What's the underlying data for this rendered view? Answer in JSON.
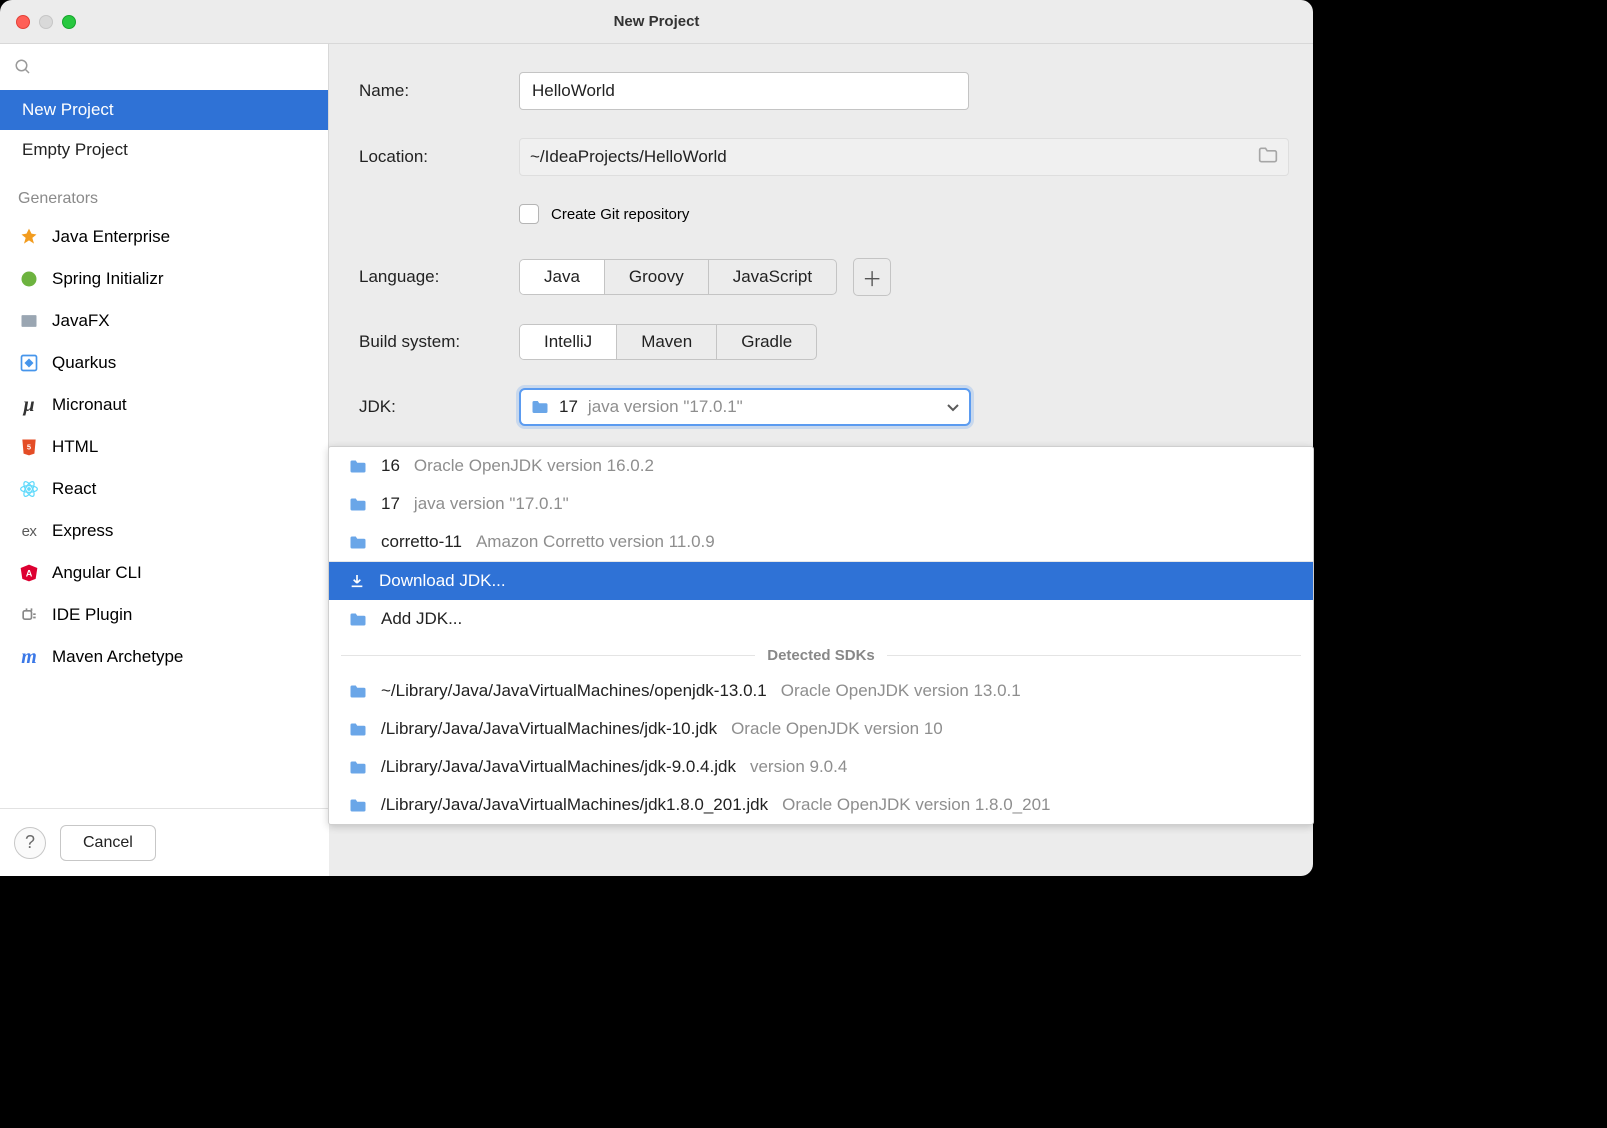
{
  "window": {
    "title": "New Project"
  },
  "sidebar": {
    "search_placeholder": "",
    "items": [
      {
        "label": "New Project",
        "selected": true
      },
      {
        "label": "Empty Project",
        "selected": false
      }
    ],
    "generators_label": "Generators",
    "generators": [
      {
        "label": "Java Enterprise",
        "icon": "rocket-icon",
        "color": "#f29c1f"
      },
      {
        "label": "Spring Initializr",
        "icon": "spring-icon",
        "color": "#6db33f"
      },
      {
        "label": "JavaFX",
        "icon": "javafx-icon",
        "color": "#888"
      },
      {
        "label": "Quarkus",
        "icon": "quarkus-icon",
        "color": "#4695eb"
      },
      {
        "label": "Micronaut",
        "icon": "micronaut-icon",
        "color": "#333"
      },
      {
        "label": "HTML",
        "icon": "html-icon",
        "color": "#e44d26"
      },
      {
        "label": "React",
        "icon": "react-icon",
        "color": "#61dafb"
      },
      {
        "label": "Express",
        "icon": "express-icon",
        "color": "#5a5a5a"
      },
      {
        "label": "Angular CLI",
        "icon": "angular-icon",
        "color": "#dd0031"
      },
      {
        "label": "IDE Plugin",
        "icon": "ide-plugin-icon",
        "color": "#888"
      },
      {
        "label": "Maven Archetype",
        "icon": "maven-icon",
        "color": "#3b78e7"
      }
    ]
  },
  "form": {
    "name_label": "Name:",
    "name_value": "HelloWorld",
    "location_label": "Location:",
    "location_value": "~/IdeaProjects/HelloWorld",
    "git_label": "Create Git repository",
    "git_checked": false,
    "language_label": "Language:",
    "language_options": [
      "Java",
      "Groovy",
      "JavaScript"
    ],
    "language_selected": "Java",
    "build_label": "Build system:",
    "build_options": [
      "IntelliJ",
      "Maven",
      "Gradle"
    ],
    "build_selected": "IntelliJ",
    "jdk_label": "JDK:",
    "jdk_selected": {
      "name": "17",
      "desc": "java version \"17.0.1\""
    }
  },
  "dropdown": {
    "installed": [
      {
        "name": "16",
        "desc": "Oracle OpenJDK version 16.0.2"
      },
      {
        "name": "17",
        "desc": "java version \"17.0.1\""
      },
      {
        "name": "corretto-11",
        "desc": "Amazon Corretto version 11.0.9"
      }
    ],
    "actions": [
      {
        "label": "Download JDK...",
        "selected": true,
        "icon": "download-icon"
      },
      {
        "label": "Add JDK...",
        "selected": false,
        "icon": "folder-icon"
      }
    ],
    "detected_header": "Detected SDKs",
    "detected": [
      {
        "name": "~/Library/Java/JavaVirtualMachines/openjdk-13.0.1",
        "desc": "Oracle OpenJDK version 13.0.1"
      },
      {
        "name": "/Library/Java/JavaVirtualMachines/jdk-10.jdk",
        "desc": "Oracle OpenJDK version 10"
      },
      {
        "name": "/Library/Java/JavaVirtualMachines/jdk-9.0.4.jdk",
        "desc": "version 9.0.4"
      },
      {
        "name": "/Library/Java/JavaVirtualMachines/jdk1.8.0_201.jdk",
        "desc": "Oracle OpenJDK version 1.8.0_201"
      }
    ]
  },
  "footer": {
    "cancel_label": "Cancel"
  }
}
